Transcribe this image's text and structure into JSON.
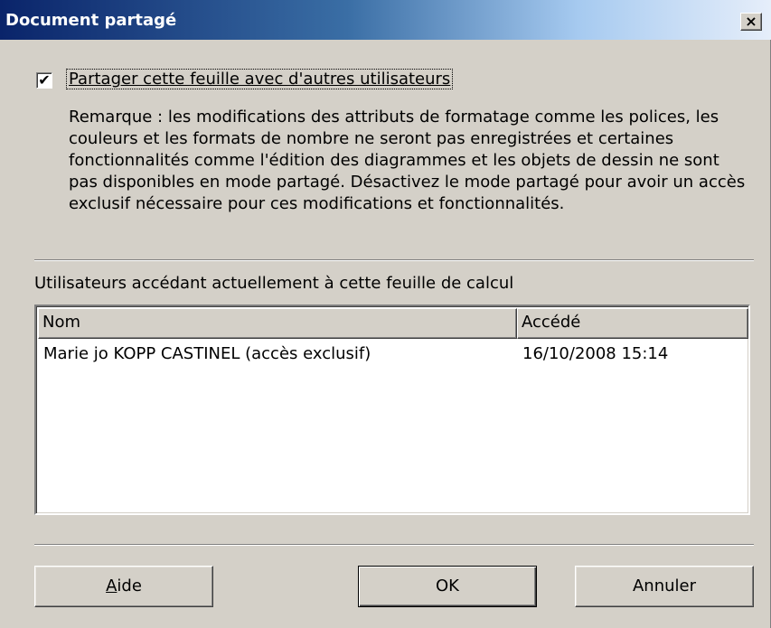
{
  "window": {
    "title": "Document partagé",
    "close_glyph": "×"
  },
  "share": {
    "checked": true,
    "check_glyph": "✔",
    "label": "Partager cette feuille avec d'autres utilisateurs",
    "remark": "Remarque : les modifications des attributs de formatage comme les polices, les couleurs et les formats de nombre ne seront pas enregistrées et certaines fonctionnalités comme l'édition des diagrammes et les objets de dessin ne sont pas disponibles en mode partagé. Désactivez le mode partagé pour avoir un accès exclusif nécessaire pour ces modifications et fonctionnalités."
  },
  "users": {
    "label": "Utilisateurs accédant actuellement à cette feuille de calcul",
    "columns": [
      "Nom",
      "Accédé"
    ],
    "rows": [
      {
        "name": "Marie jo KOPP CASTINEL (accès exclusif)",
        "accessed": "16/10/2008 15:14"
      }
    ]
  },
  "buttons": {
    "help_accel": "A",
    "help_rest": "ide",
    "ok": "OK",
    "cancel": "Annuler"
  },
  "colors": {
    "title_start": "#0a246a",
    "title_end": "#e6eefa",
    "face": "#d4d0c8"
  }
}
